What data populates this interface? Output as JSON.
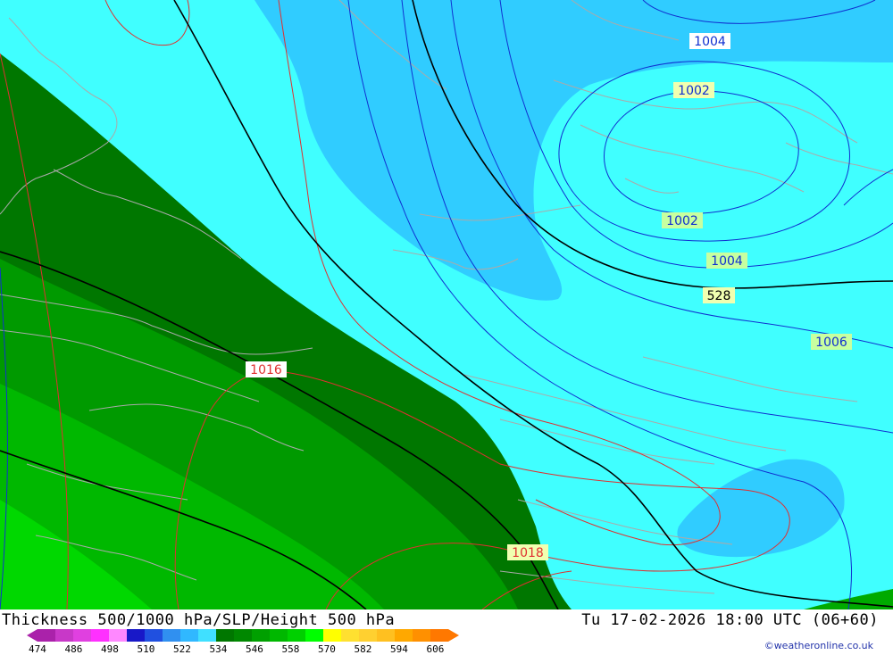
{
  "header": {
    "title": "Thickness 500/1000 hPa/SLP/Height 500 hPa",
    "datetime": "Tu 17-02-2026 18:00 UTC (06+60)"
  },
  "credit": "©weatheronline.co.uk",
  "legend": {
    "colors": [
      "#aa22aa",
      "#c838c8",
      "#e040e0",
      "#ff30ff",
      "#ff88ff",
      "#1818c8",
      "#2050e0",
      "#3090f0",
      "#30b8ff",
      "#40e0ff",
      "#007700",
      "#008800",
      "#00a000",
      "#00b800",
      "#00d000",
      "#00ff00",
      "#ffff00",
      "#ffe030",
      "#ffd030",
      "#ffc020",
      "#ffa800",
      "#ff9000",
      "#ff7800"
    ],
    "values": [
      "474",
      "486",
      "498",
      "510",
      "522",
      "534",
      "546",
      "558",
      "570",
      "582",
      "594",
      "606"
    ]
  },
  "map": {
    "contour_labels": [
      {
        "id": "slp-1004-top",
        "text": "1004",
        "kind": "slp-blue"
      },
      {
        "id": "slp-1002-top",
        "text": "1002",
        "kind": "slp-yellow-blue"
      },
      {
        "id": "slp-1002-mid",
        "text": "1002",
        "kind": "slp-yellow"
      },
      {
        "id": "slp-1004-mid",
        "text": "1004",
        "kind": "slp-yellow"
      },
      {
        "id": "h500-528",
        "text": "528",
        "kind": "height"
      },
      {
        "id": "slp-1006",
        "text": "1006",
        "kind": "slp-yellow"
      },
      {
        "id": "slp-1016",
        "text": "1016",
        "kind": "slp-red"
      },
      {
        "id": "slp-1018",
        "text": "1018",
        "kind": "slp-red"
      }
    ],
    "colors": {
      "cyan": "#40ffff",
      "blue": "#30ccff",
      "green_dark": "#007700",
      "green_mid": "#009a00",
      "green_light": "#00b800",
      "green_bright": "#00d800",
      "isobar_blue": "#1030d0",
      "isobar_red": "#e03030",
      "height_line": "#000000",
      "coast": "#aaaaaa"
    }
  }
}
